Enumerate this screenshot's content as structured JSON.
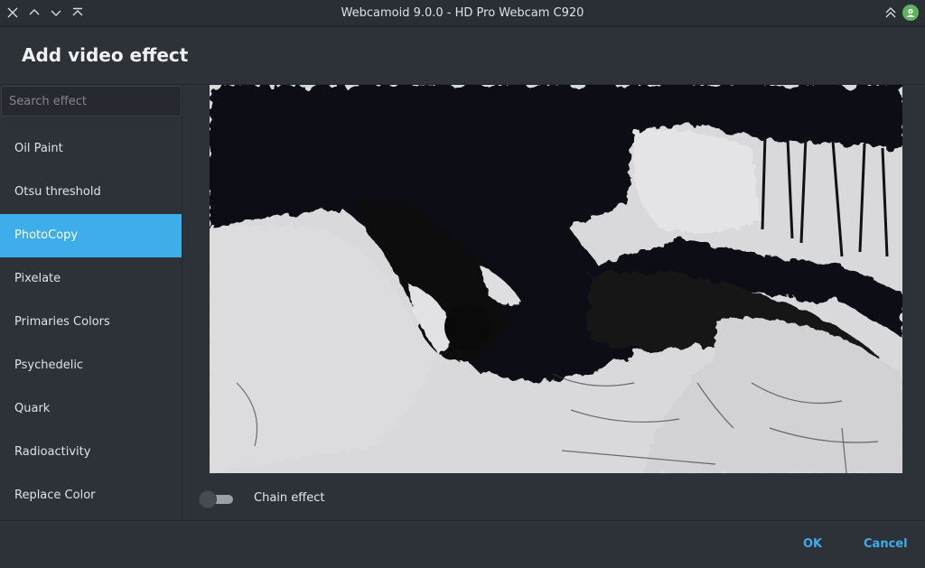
{
  "window": {
    "title": "Webcamoid 9.0.0 - HD Pro Webcam C920",
    "controls": [
      "close-icon",
      "minimize-icon",
      "maximize-icon",
      "keep-above-icon"
    ],
    "right_icons": [
      "keep-above-up-icon",
      "webcamoid-app-icon"
    ]
  },
  "header": {
    "title": "Add video effect"
  },
  "sidebar": {
    "search_placeholder": "Search effect",
    "search_value": "",
    "items": [
      {
        "label": "Oil Paint",
        "selected": false
      },
      {
        "label": "Otsu threshold",
        "selected": false
      },
      {
        "label": "PhotoCopy",
        "selected": true
      },
      {
        "label": "Pixelate",
        "selected": false
      },
      {
        "label": "Primaries Colors",
        "selected": false
      },
      {
        "label": "Psychedelic",
        "selected": false
      },
      {
        "label": "Quark",
        "selected": false
      },
      {
        "label": "Radioactivity",
        "selected": false
      },
      {
        "label": "Replace Color",
        "selected": false
      }
    ]
  },
  "chain": {
    "label": "Chain effect",
    "enabled": false
  },
  "footer": {
    "ok_label": "OK",
    "cancel_label": "Cancel"
  },
  "colors": {
    "accent": "#3daee9",
    "background": "#2d3138",
    "titlebar": "#2a2e35",
    "text": "#e6e8eb"
  }
}
